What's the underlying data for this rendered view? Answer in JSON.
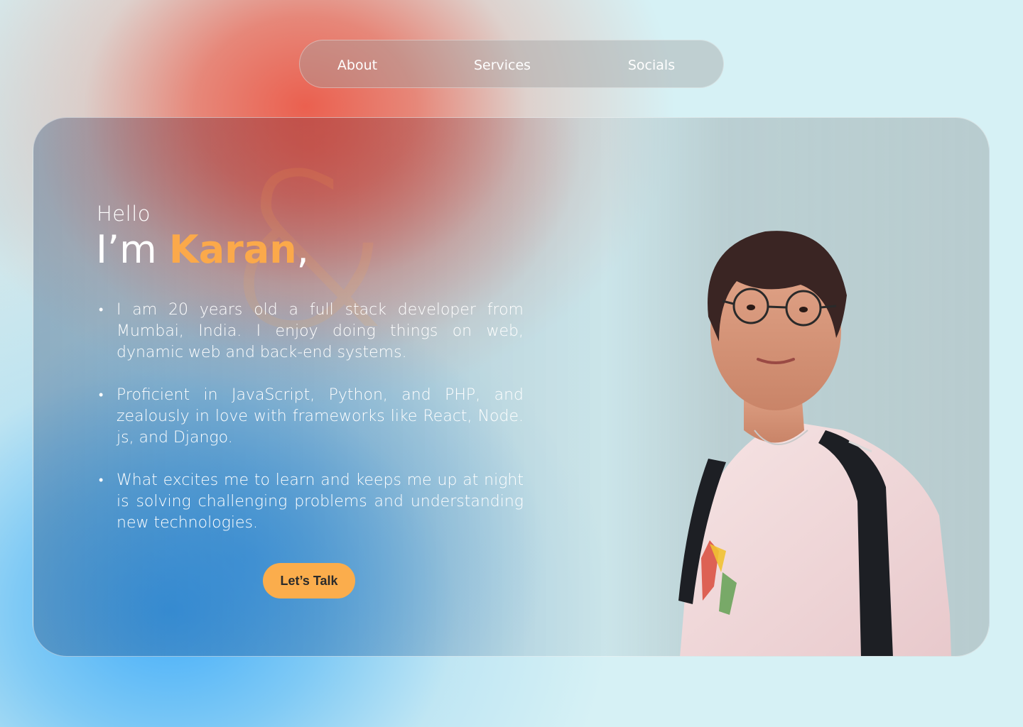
{
  "nav": {
    "about": "About",
    "services": "Services",
    "socials": "Socials"
  },
  "hero": {
    "greeting": "Hello",
    "intro_prefix": "I’m ",
    "name": "Karan",
    "intro_suffix": ",",
    "watermark": "&",
    "bullets": [
      "I am 20 years old  a full stack developer from Mumbai, India. I enjoy doing things on web, dynamic web and back-end systems.",
      "Proficient in JavaScript, Python, and PHP, and zealously in love with frameworks like React, Node. js, and Django.",
      "What excites me to learn and keeps me up at night is solving challenging problems and understanding new technologies."
    ],
    "cta_label": "Let’s Talk"
  },
  "colors": {
    "accent": "#fba94a",
    "button": "#fbad4c",
    "card_right": "#b8ccd0"
  }
}
